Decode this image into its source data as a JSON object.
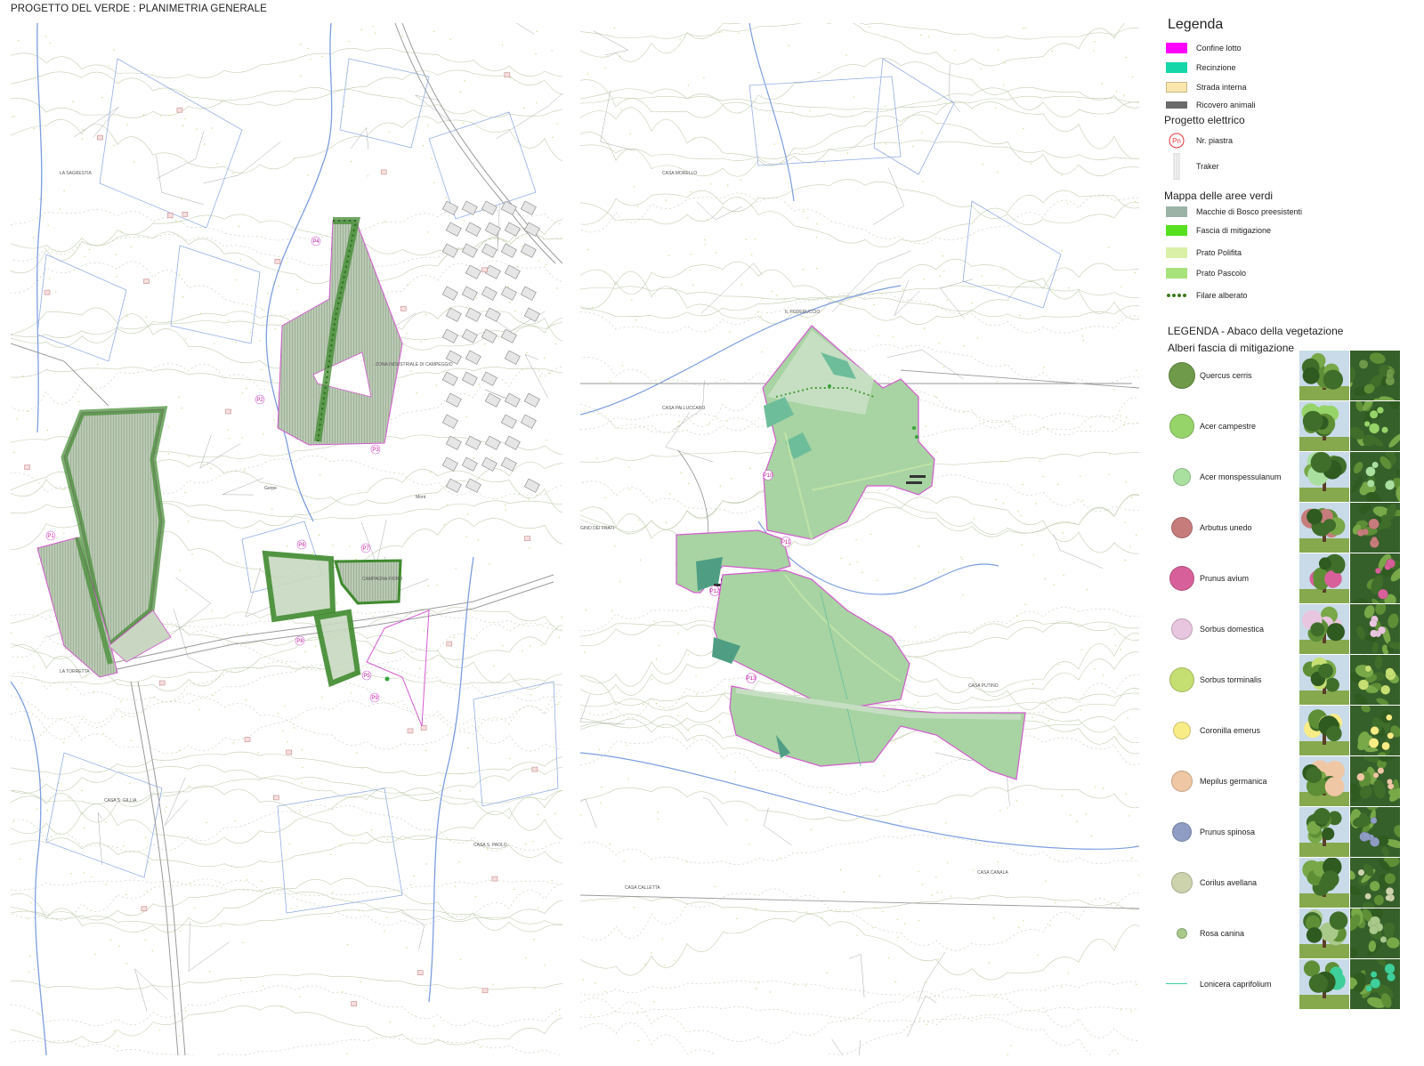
{
  "page_title": "PROGETTO DEL VERDE : PLANIMETRIA GENERALE",
  "colors": {
    "confine_lotto": "#ff00ff",
    "recinzione": "#14d6a8",
    "strada_interna": "#fce8ad",
    "ricovero_animali": "#6a6a6a",
    "macchie_bosco": "#9ab3a6",
    "fascia_mitigazione": "#55e020",
    "prato_polifita": "#d9f0a6",
    "prato_pascolo": "#a8e27c",
    "filare_alberato": "#3d7a1c",
    "contour": "#b8c9a8",
    "river": "#6b8fd6",
    "plot_outline": "#d45bd0"
  },
  "legend": {
    "title": "Legenda",
    "items": [
      {
        "label": "Confine lotto",
        "swatch": "confine_lotto"
      },
      {
        "label": "Recinzione",
        "swatch": "recinzione"
      },
      {
        "label": "Strada interna",
        "swatch": "strada_interna"
      },
      {
        "label": "Ricovero animali",
        "swatch": "ricovero_animali"
      }
    ],
    "progetto_elettrico": {
      "title": "Progetto elettrico",
      "piastra_symbol": "Pn",
      "piastra_label": "Nr. piastra",
      "traker_label": "Traker"
    },
    "aree_verdi": {
      "title": "Mappa delle aree verdi",
      "items": [
        {
          "label": "Macchie di Bosco preesistenti",
          "swatch": "macchie_bosco"
        },
        {
          "label": "Fascia di mitigazione",
          "swatch": "fascia_mitigazione"
        },
        {
          "label": "Prato Polifita",
          "swatch": "prato_polifita"
        },
        {
          "label": "Prato Pascolo",
          "swatch": "prato_pascolo"
        },
        {
          "label": "Filare alberato",
          "swatch": "filare_alberato"
        }
      ]
    }
  },
  "vegetation": {
    "title": "LEGENDA - Abaco della vegetazione",
    "subtitle": "Alberi fascia di mitigazione",
    "species": [
      {
        "name": "Quercus cerris",
        "color": "#6f9a4a",
        "icon": "tree-photo"
      },
      {
        "name": "Acer campestre",
        "color": "#96d46a",
        "icon": "tree-photo"
      },
      {
        "name": "Acer monspessulanum",
        "color": "#a9e0a0",
        "icon": "tree-photo"
      },
      {
        "name": "Arbutus unedo",
        "color": "#c77c7c",
        "icon": "tree-photo"
      },
      {
        "name": "Prunus avium",
        "color": "#d8609a",
        "icon": "tree-photo"
      },
      {
        "name": "Sorbus domestica",
        "color": "#e8c6df",
        "icon": "tree-photo"
      },
      {
        "name": "Sorbus torminalis",
        "color": "#c5df73",
        "icon": "tree-photo"
      },
      {
        "name": "Coronilla emerus",
        "color": "#f8ec86",
        "icon": "tree-photo"
      },
      {
        "name": "Mepilus germanica",
        "color": "#f0c7a4",
        "icon": "tree-photo"
      },
      {
        "name": "Prunus spinosa",
        "color": "#8f9dc4",
        "icon": "tree-photo"
      },
      {
        "name": "Corilus avellana",
        "color": "#cdd3ad",
        "icon": "tree-photo"
      },
      {
        "name": "Rosa canina",
        "color": "#a8c98a",
        "icon": "tree-photo"
      },
      {
        "name": "Lonicera caprifolium",
        "color": "#3ecf9a",
        "icon": "tree-photo"
      }
    ]
  },
  "map_left": {
    "plots": [
      "P1",
      "P2",
      "P3",
      "P4",
      "P5",
      "P6",
      "P7",
      "P8",
      "P9"
    ],
    "places": [
      "LA SAGRESTIA",
      "LA TORRETTA",
      "CASA S. GILLIA",
      "CASA S. PAOLO",
      "ZONA INDUSTRIALE DI CAMPEGGIO",
      "CAMPAGNA FIORO",
      "Gerpe",
      "Mont"
    ]
  },
  "map_right": {
    "plots": [
      "P10",
      "P11",
      "P12",
      "P13"
    ],
    "places": [
      "IL PODERUCCIO",
      "CASA PALLUCCARO",
      "CASA MORELLO",
      "GINO DEI FRATI",
      "CASA PUTINO",
      "CASA CALLETTA",
      "CASA CANALA"
    ]
  }
}
